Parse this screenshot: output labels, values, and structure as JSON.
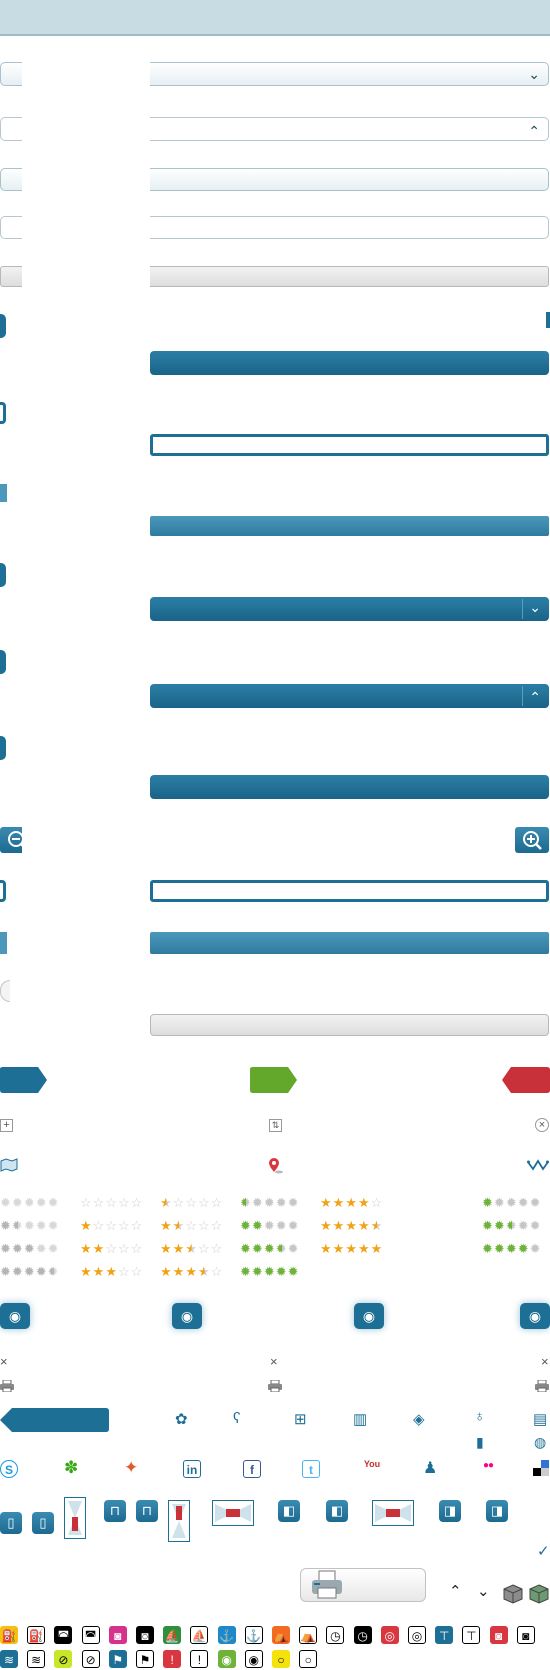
{
  "colors": {
    "primary_blue": "#1e6f96",
    "header_bg": "#c8dde3",
    "green": "#63a82a",
    "red": "#c8313a",
    "star_gold": "#f1a317"
  },
  "chevrons": {
    "down": "⌄",
    "up": "⌃"
  },
  "zoom": {
    "out_symbol": "−",
    "in_symbol": "+"
  },
  "small_icons": {
    "plus": "+",
    "sort": "⇅",
    "close_circle": "×",
    "close_a": "×",
    "close_b": "×",
    "close_c": "×",
    "check": "✓",
    "eye": "◉"
  },
  "ratings": [
    {
      "value": 0
    },
    {
      "value": 0.5
    },
    {
      "value": 1
    },
    {
      "value": 1.5
    },
    {
      "value": 2
    },
    {
      "value": 2.5
    },
    {
      "value": 3
    },
    {
      "value": 3.5
    },
    {
      "value": 4
    },
    {
      "value": 4.5
    },
    {
      "value": 5
    }
  ],
  "social": {
    "skype": "S",
    "linkedin": "in",
    "facebook": "f",
    "twitter": "t",
    "youtube": "You",
    "flickr": "●●"
  },
  "icon_row_labels": {
    "fuel": "⛽",
    "ship": "⛵",
    "anchor": "⚓",
    "clock": "◷",
    "wifi": "◎",
    "tent": "⛺",
    "swim": "≋",
    "info": "!",
    "bulb": "○"
  }
}
